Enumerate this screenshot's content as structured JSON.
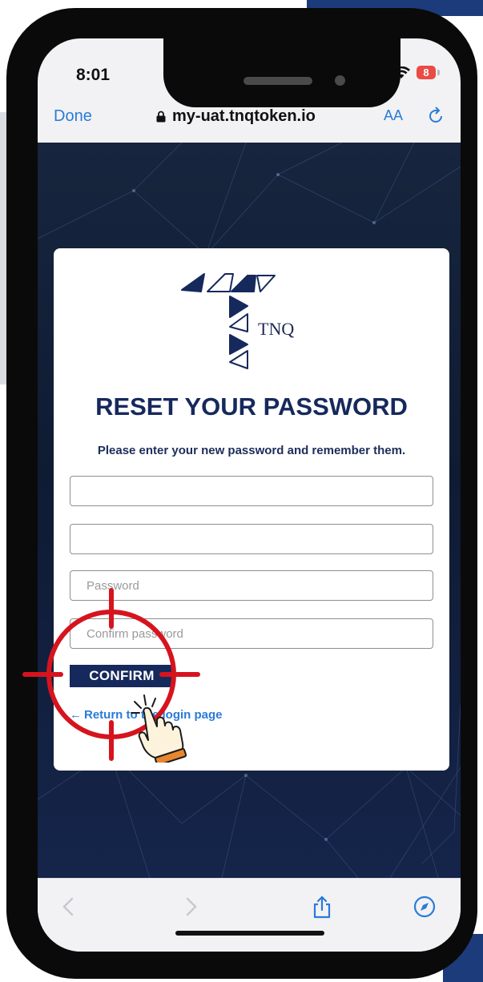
{
  "status_bar": {
    "time": "8:01",
    "battery_level": "8"
  },
  "browser": {
    "done_label": "Done",
    "url": "my-uat.tnqtoken.io",
    "text_size_label": "AA",
    "reload_icon": "reload-icon",
    "lock_icon": "lock-icon"
  },
  "page": {
    "logo_text": "TNQ",
    "title": "RESET YOUR PASSWORD",
    "subtitle": "Please enter your new password and remember them.",
    "fields": [
      {
        "placeholder": "",
        "value": ""
      },
      {
        "placeholder": "",
        "value": ""
      },
      {
        "placeholder": "Password",
        "value": ""
      },
      {
        "placeholder": "Confirm password",
        "value": ""
      }
    ],
    "confirm_label": "CONFIRM",
    "back_link_arrow": "←",
    "back_link_label": "Return to the login page"
  },
  "toolbar": {
    "back_icon": "chevron-left-icon",
    "forward_icon": "chevron-right-icon",
    "share_icon": "share-icon",
    "compass_icon": "compass-icon"
  },
  "colors": {
    "brand_navy": "#16295c",
    "link_blue": "#2a7bd8",
    "target_red": "#d6141e",
    "background_navy": "#0f1b33"
  }
}
